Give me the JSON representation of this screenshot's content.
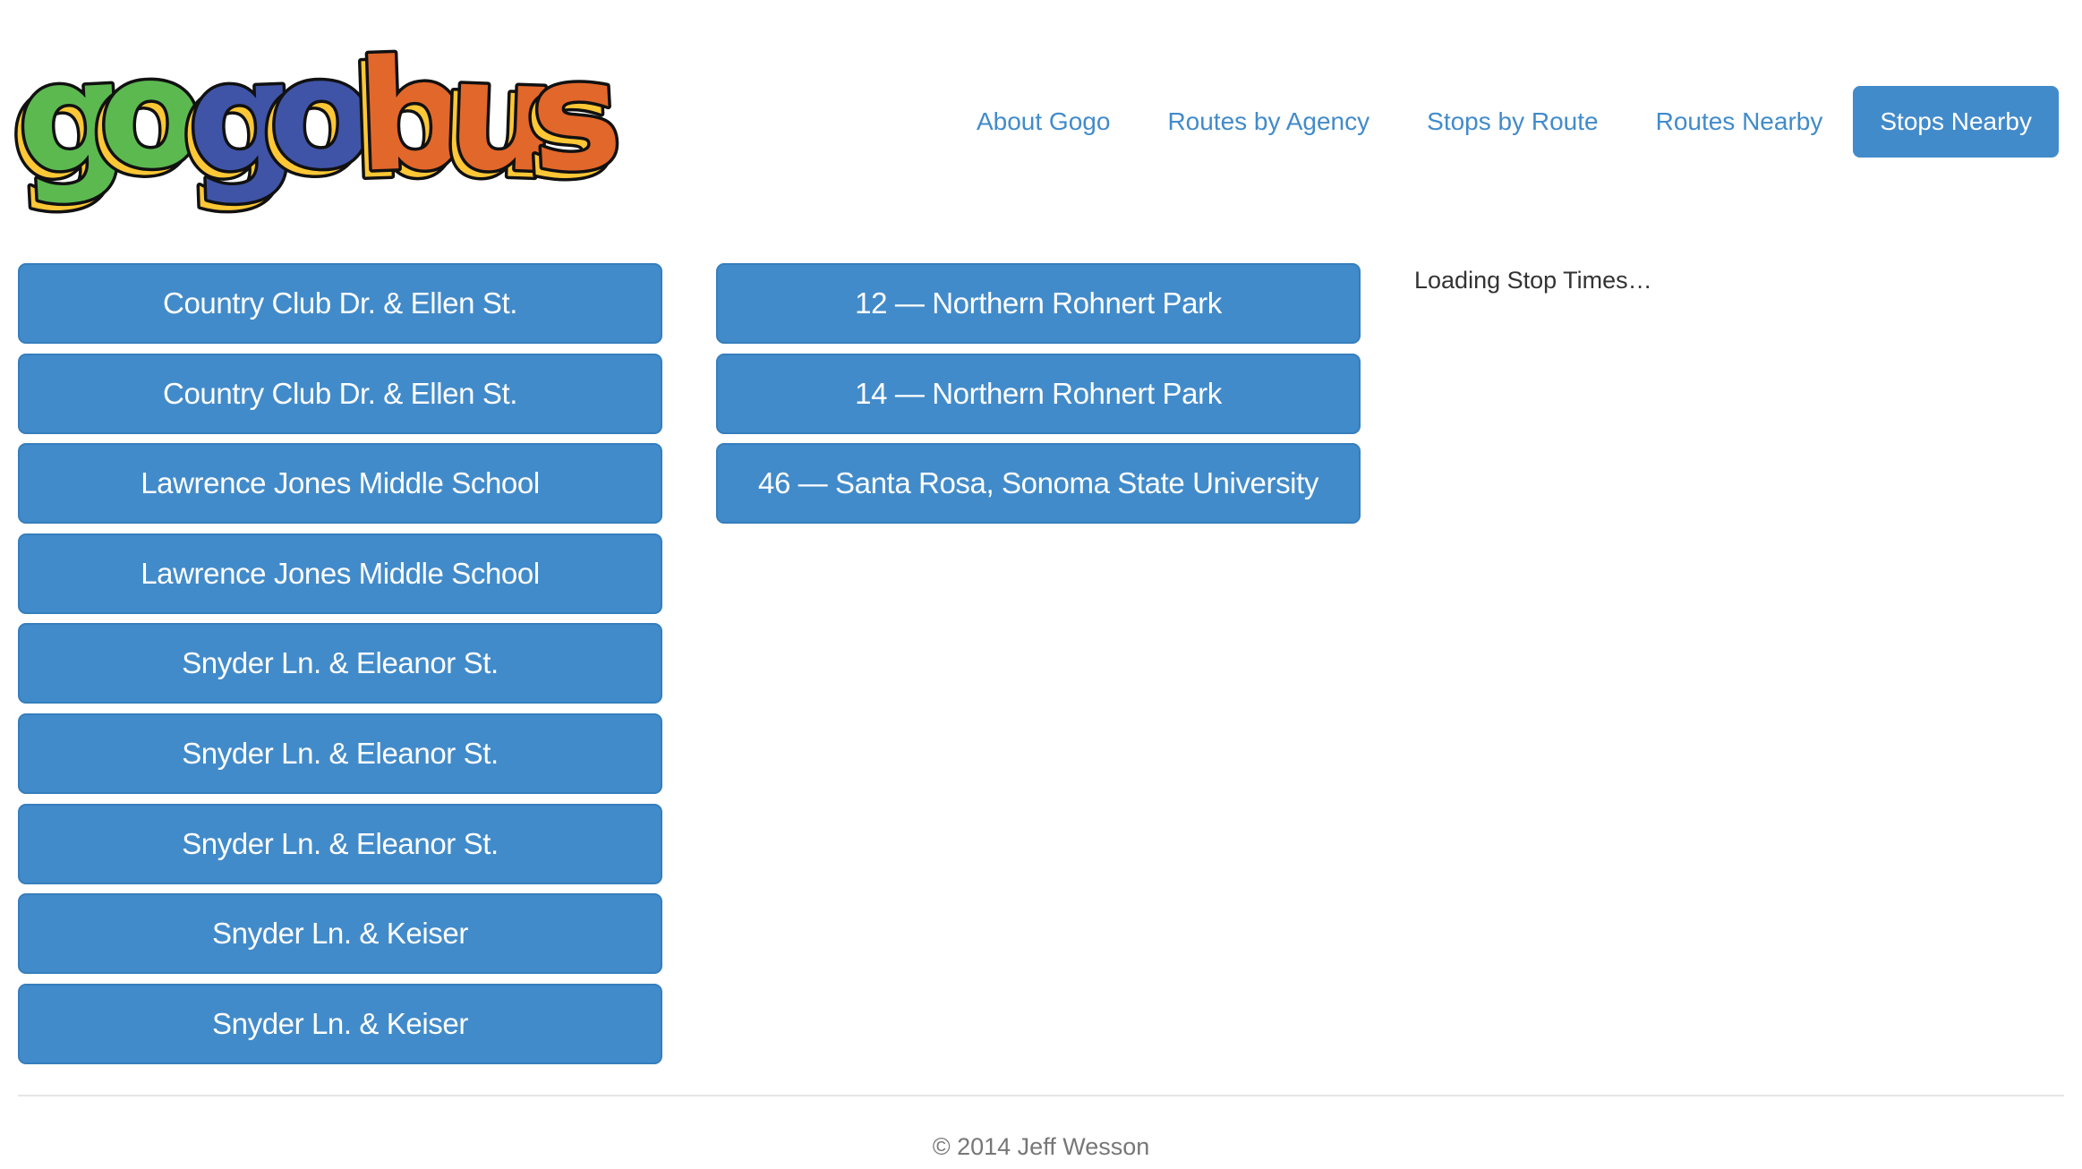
{
  "brand": {
    "logo_text": "gogobus",
    "logo_letters": [
      {
        "char": "g",
        "color": "#5cb950"
      },
      {
        "char": "o",
        "color": "#5cb950"
      },
      {
        "char": "g",
        "color": "#3f54a6"
      },
      {
        "char": "o",
        "color": "#3f54a6"
      },
      {
        "char": "b",
        "color": "#e2672a"
      },
      {
        "char": "u",
        "color": "#e2672a"
      },
      {
        "char": "s",
        "color": "#e2672a"
      }
    ],
    "shadow_color": "#fdc736"
  },
  "nav": {
    "items": [
      {
        "label": "About Gogo",
        "active": false
      },
      {
        "label": "Routes by Agency",
        "active": false
      },
      {
        "label": "Stops by Route",
        "active": false
      },
      {
        "label": "Routes Nearby",
        "active": false
      },
      {
        "label": "Stops Nearby",
        "active": true
      }
    ]
  },
  "stops": [
    {
      "name": "Country Club Dr. & Ellen St."
    },
    {
      "name": "Country Club Dr. & Ellen St."
    },
    {
      "name": "Lawrence Jones Middle School"
    },
    {
      "name": "Lawrence Jones Middle School"
    },
    {
      "name": "Snyder Ln. & Eleanor St."
    },
    {
      "name": "Snyder Ln. & Eleanor St."
    },
    {
      "name": "Snyder Ln. & Eleanor St."
    },
    {
      "name": "Snyder Ln. & Keiser"
    },
    {
      "name": "Snyder Ln. & Keiser"
    }
  ],
  "routes": [
    {
      "label": "12 — Northern Rohnert Park"
    },
    {
      "label": "14 — Northern Rohnert Park"
    },
    {
      "label": "46 — Santa Rosa, Sonoma State University"
    }
  ],
  "stop_times": {
    "status": "Loading Stop Times…"
  },
  "footer": {
    "copyright": "© 2014 Jeff Wesson"
  },
  "colors": {
    "primary": "#428bca",
    "primary_border": "#357ebd",
    "link": "#428bca",
    "footer_text": "#777777",
    "rule": "#e5e5e5"
  }
}
